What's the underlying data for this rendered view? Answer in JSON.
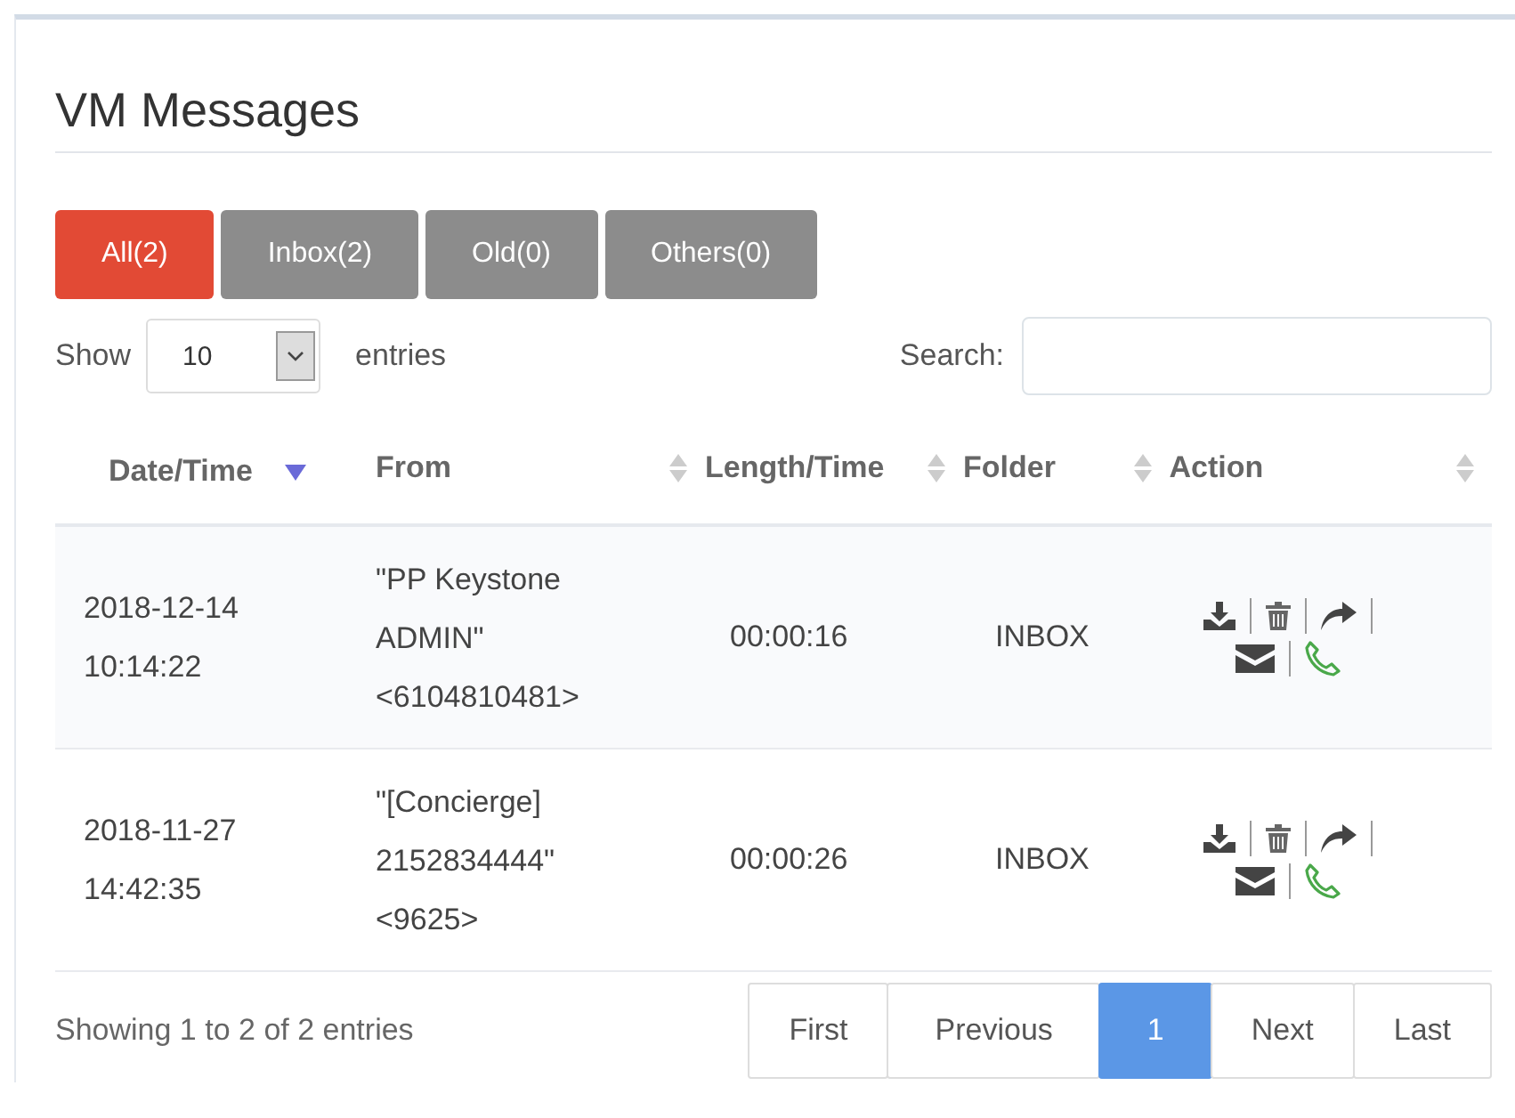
{
  "panel": {
    "title": "VM Messages"
  },
  "filters": [
    {
      "label": "All(2)",
      "selected": true
    },
    {
      "label": "Inbox(2)",
      "selected": false
    },
    {
      "label": "Old(0)",
      "selected": false
    },
    {
      "label": "Others(0)",
      "selected": false
    }
  ],
  "length_menu": {
    "prefix": "Show",
    "value": "10",
    "suffix": "entries"
  },
  "search": {
    "label": "Search:"
  },
  "table": {
    "columns": [
      {
        "label": "Date/Time",
        "sorted": true
      },
      {
        "label": "From",
        "sorted": false
      },
      {
        "label": "Length/Time",
        "sorted": false
      },
      {
        "label": "Folder",
        "sorted": false
      },
      {
        "label": "Action",
        "sorted": false
      }
    ],
    "rows": [
      {
        "date": "2018-12-14",
        "time": "10:14:22",
        "from": [
          "\"PP Keystone",
          "ADMIN\"",
          "<6104810481>"
        ],
        "length": "00:00:16",
        "folder": "INBOX"
      },
      {
        "date": "2018-11-27",
        "time": "14:42:35",
        "from": [
          "\"[Concierge]",
          "2152834444\"",
          "<9625>"
        ],
        "length": "00:00:26",
        "folder": "INBOX"
      }
    ]
  },
  "info": "Showing 1 to 2 of 2 entries",
  "pagination": [
    {
      "label": "First",
      "selected": false
    },
    {
      "label": "Previous",
      "selected": false
    },
    {
      "label": "1",
      "selected": true
    },
    {
      "label": "Next",
      "selected": false
    },
    {
      "label": "Last",
      "selected": false
    }
  ]
}
